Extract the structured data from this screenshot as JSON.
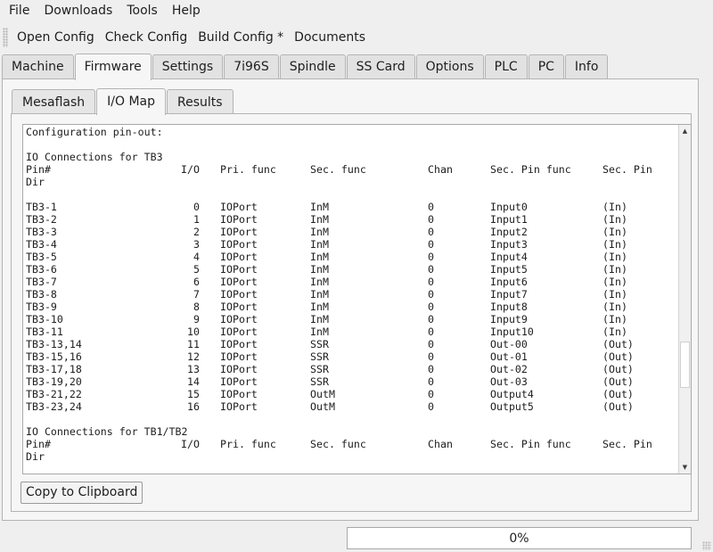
{
  "menubar": {
    "items": [
      "File",
      "Downloads",
      "Tools",
      "Help"
    ]
  },
  "toolbar": {
    "items": [
      "Open Config",
      "Check Config",
      "Build Config *",
      "Documents"
    ]
  },
  "tabs": [
    "Machine",
    "Firmware",
    "Settings",
    "7i96S",
    "Spindle",
    "SS Card",
    "Options",
    "PLC",
    "PC",
    "Info"
  ],
  "active_tab": "Firmware",
  "subtabs": [
    "Mesaflash",
    "I/O Map",
    "Results"
  ],
  "active_subtab": "I/O Map",
  "io_map": {
    "title": "Configuration pin-out:",
    "sections": [
      {
        "heading": "IO Connections for TB3",
        "columns": [
          "Pin#",
          "I/O",
          "Pri. func",
          "Sec. func",
          "Chan",
          "Sec. Pin func",
          "Sec. Pin"
        ],
        "dir_label": "Dir",
        "rows": [
          [
            "TB3-1",
            "0",
            "IOPort",
            "InM",
            "0",
            "Input0",
            "(In)"
          ],
          [
            "TB3-2",
            "1",
            "IOPort",
            "InM",
            "0",
            "Input1",
            "(In)"
          ],
          [
            "TB3-3",
            "2",
            "IOPort",
            "InM",
            "0",
            "Input2",
            "(In)"
          ],
          [
            "TB3-4",
            "3",
            "IOPort",
            "InM",
            "0",
            "Input3",
            "(In)"
          ],
          [
            "TB3-5",
            "4",
            "IOPort",
            "InM",
            "0",
            "Input4",
            "(In)"
          ],
          [
            "TB3-6",
            "5",
            "IOPort",
            "InM",
            "0",
            "Input5",
            "(In)"
          ],
          [
            "TB3-7",
            "6",
            "IOPort",
            "InM",
            "0",
            "Input6",
            "(In)"
          ],
          [
            "TB3-8",
            "7",
            "IOPort",
            "InM",
            "0",
            "Input7",
            "(In)"
          ],
          [
            "TB3-9",
            "8",
            "IOPort",
            "InM",
            "0",
            "Input8",
            "(In)"
          ],
          [
            "TB3-10",
            "9",
            "IOPort",
            "InM",
            "0",
            "Input9",
            "(In)"
          ],
          [
            "TB3-11",
            "10",
            "IOPort",
            "InM",
            "0",
            "Input10",
            "(In)"
          ],
          [
            "TB3-13,14",
            "11",
            "IOPort",
            "SSR",
            "0",
            "Out-00",
            "(Out)"
          ],
          [
            "TB3-15,16",
            "12",
            "IOPort",
            "SSR",
            "0",
            "Out-01",
            "(Out)"
          ],
          [
            "TB3-17,18",
            "13",
            "IOPort",
            "SSR",
            "0",
            "Out-02",
            "(Out)"
          ],
          [
            "TB3-19,20",
            "14",
            "IOPort",
            "SSR",
            "0",
            "Out-03",
            "(Out)"
          ],
          [
            "TB3-21,22",
            "15",
            "IOPort",
            "OutM",
            "0",
            "Output4",
            "(Out)"
          ],
          [
            "TB3-23,24",
            "16",
            "IOPort",
            "OutM",
            "0",
            "Output5",
            "(Out)"
          ]
        ]
      },
      {
        "heading": "IO Connections for TB1/TB2",
        "columns": [
          "Pin#",
          "I/O",
          "Pri. func",
          "Sec. func",
          "Chan",
          "Sec. Pin func",
          "Sec. Pin"
        ],
        "dir_label": "Dir",
        "rows": []
      }
    ],
    "scroll_position": 0.55
  },
  "copy_button": "Copy to Clipboard",
  "progress": {
    "value": 0,
    "label": "0%",
    "fill_color": "#3d8ee0"
  },
  "icons": {
    "scroll_up": "triangle-up-icon",
    "scroll_down": "triangle-down-icon"
  }
}
